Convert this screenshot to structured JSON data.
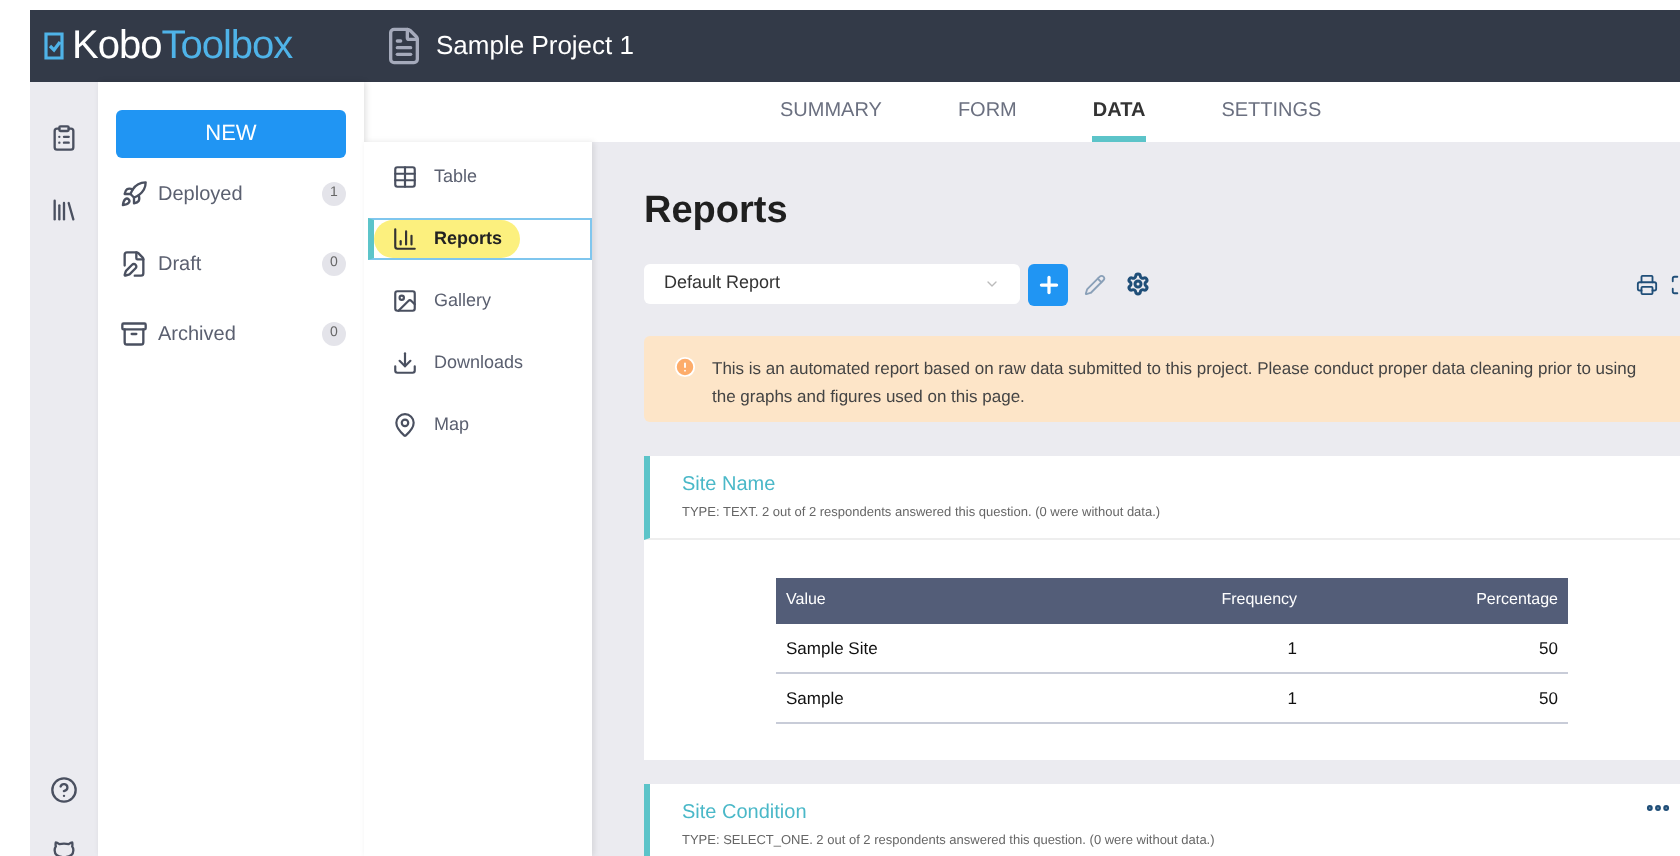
{
  "header": {
    "logo_part_1": "Kobo",
    "logo_part_2": "Toolbox",
    "project_title": "Sample Project 1"
  },
  "tabs": [
    {
      "label": "SUMMARY",
      "selected": false
    },
    {
      "label": "FORM",
      "selected": false
    },
    {
      "label": "DATA",
      "selected": true
    },
    {
      "label": "SETTINGS",
      "selected": false
    }
  ],
  "sidebar": {
    "new_button": "NEW",
    "items": [
      {
        "kind": "deployed",
        "label": "Deployed",
        "count": "1"
      },
      {
        "kind": "draft",
        "label": "Draft",
        "count": "0"
      },
      {
        "kind": "archived",
        "label": "Archived",
        "count": "0"
      }
    ]
  },
  "data_nav": [
    {
      "kind": "table",
      "label": "Table",
      "selected": false
    },
    {
      "kind": "reports",
      "label": "Reports",
      "selected": true
    },
    {
      "kind": "gallery",
      "label": "Gallery",
      "selected": false
    },
    {
      "kind": "downloads",
      "label": "Downloads",
      "selected": false
    },
    {
      "kind": "map",
      "label": "Map",
      "selected": false
    }
  ],
  "page_title": "Reports",
  "report_select": {
    "value": "Default Report"
  },
  "notice": "This is an automated report based on raw data submitted to this project. Please conduct proper data cleaning prior to using the graphs and figures used on this page.",
  "questions": [
    {
      "title": "Site Name",
      "meta": "TYPE: TEXT. 2 out of 2 respondents answered this question. (0 were without data.)",
      "has_menu": false,
      "table": {
        "columns": [
          "Value",
          "Frequency",
          "Percentage"
        ],
        "rows": [
          [
            "Sample Site",
            "1",
            "50"
          ],
          [
            "Sample",
            "1",
            "50"
          ]
        ]
      }
    },
    {
      "title": "Site Condition",
      "meta": "TYPE: SELECT_ONE. 2 out of 2 respondents answered this question. (0 were without data.)",
      "has_menu": true
    }
  ]
}
